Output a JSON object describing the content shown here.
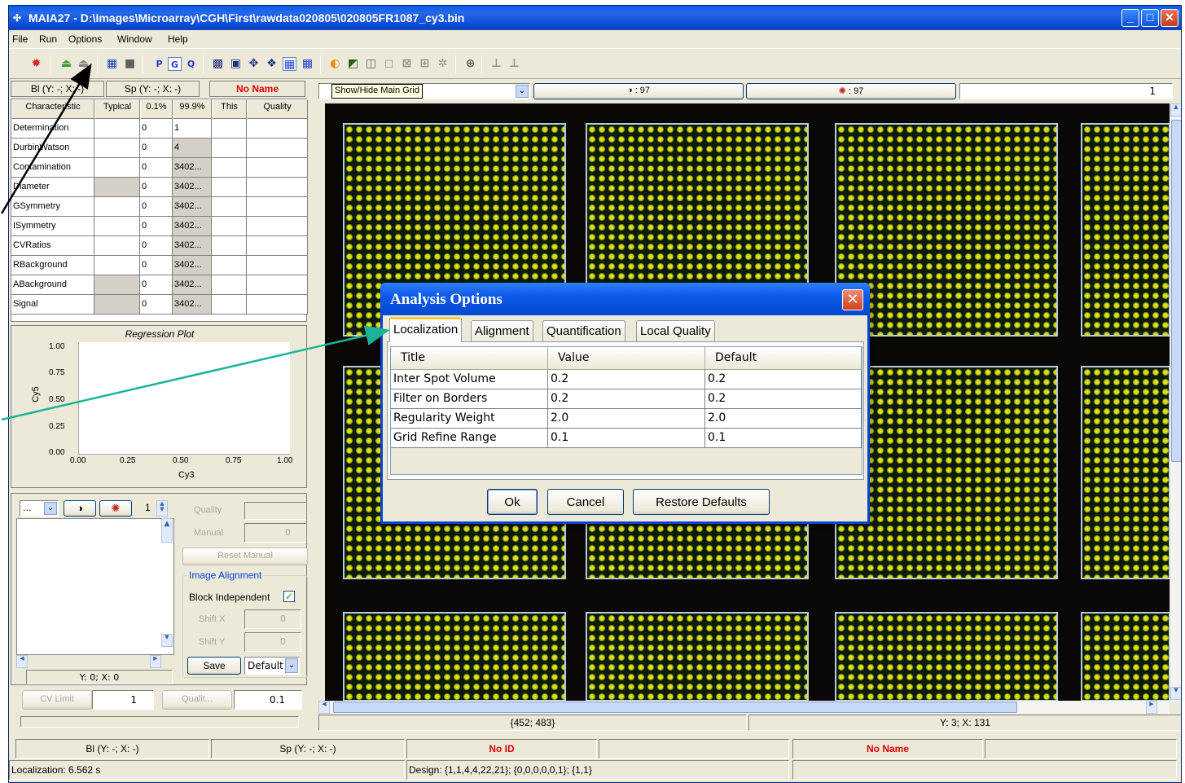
{
  "window": {
    "title": "MAIA27 - D:\\Images\\Microarray\\CGH\\First\\rawdata020805\\020805FR1087_cy3.bin"
  },
  "menu": [
    "File",
    "Run",
    "Options",
    "Window",
    "Help"
  ],
  "toolbar": {
    "tooltip": "Show/Hide Main Grid",
    "p": "P",
    "g": "G",
    "q": "Q"
  },
  "left": {
    "tabs": {
      "bl": "Bl (Y: -; X: -)",
      "sp": "Sp (Y: -; X: -)",
      "name": "No Name"
    },
    "table": {
      "headers": [
        "Characteristic",
        "Typical",
        "0.1%",
        "99.9%",
        "This",
        "Quality"
      ],
      "rows": [
        [
          "Determination",
          "",
          "0",
          "1",
          "",
          ""
        ],
        [
          "DurbinWatson",
          "",
          "0",
          "4",
          "",
          ""
        ],
        [
          "Contamination",
          "",
          "0",
          "3402...",
          "",
          ""
        ],
        [
          "Diameter",
          "",
          "0",
          "3402...",
          "",
          ""
        ],
        [
          "GSymmetry",
          "",
          "0",
          "3402...",
          "",
          ""
        ],
        [
          "ISymmetry",
          "",
          "0",
          "3402...",
          "",
          ""
        ],
        [
          "CVRatios",
          "",
          "0",
          "3402...",
          "",
          ""
        ],
        [
          "RBackground",
          "",
          "0",
          "3402...",
          "",
          ""
        ],
        [
          "ABackground",
          "",
          "0",
          "3402...",
          "",
          ""
        ],
        [
          "Signal",
          "",
          "0",
          "3402...",
          "",
          ""
        ]
      ]
    },
    "plot": {
      "title": "Regression Plot",
      "xlabel": "Cy3",
      "ylabel": "Cy5",
      "xticks": [
        "0.00",
        "0.25",
        "0.50",
        "0.75",
        "1.00"
      ],
      "yticks": [
        "1.00",
        "0.75",
        "0.50",
        "0.25",
        "0.00"
      ]
    },
    "controls": {
      "combo": "...",
      "spin1": "1",
      "quality": "Quality",
      "manual": "Manual",
      "manual_val": "0",
      "reset": "Reset Manual",
      "image_alignment": "Image Alignment",
      "block_independent": "Block Independent",
      "shiftx": "Shift X",
      "shiftx_val": "0",
      "shifty": "Shift Y",
      "shifty_val": "0",
      "save": "Save",
      "default": "Default",
      "coord": "Y: 0; X: 0",
      "cv_limit": "CV Limit",
      "cv_val": "1",
      "qualit": "Qualit...",
      "qualit_val": "0.1"
    }
  },
  "image": {
    "counter1": ": 97",
    "counter2": ": 97",
    "spin": "1",
    "status_left": "{452; 483}",
    "status_right": "Y: 3; X: 131"
  },
  "dialog": {
    "title": "Analysis Options",
    "tabs": [
      "Localization",
      "Alignment",
      "Quantification",
      "Local Quality"
    ],
    "headers": [
      "Title",
      "Value",
      "Default"
    ],
    "rows": [
      [
        "Inter Spot Volume",
        "0.2",
        "0.2"
      ],
      [
        "Filter on Borders",
        "0.2",
        "0.2"
      ],
      [
        "Regularity Weight",
        "2.0",
        "2.0"
      ],
      [
        "Grid Refine Range",
        "0.1",
        "0.1"
      ]
    ],
    "ok": "Ok",
    "cancel": "Cancel",
    "restore": "Restore Defaults"
  },
  "statusbar": {
    "bl": "Bl (Y: -; X: -)",
    "sp": "Sp (Y: -; X: -)",
    "noid": "No ID",
    "noname": "No Name",
    "localization": "Localization: 6.562 s",
    "design": "Design: {1,1,4,4,22,21}; {0,0,0,0,0,1}; {1,1}"
  },
  "colors": {
    "title_blue": "#0a5cea",
    "arrow_black": "#000000",
    "arrow_teal": "#1ab39a",
    "spot_yellow": "#f2e21a",
    "error_red": "#e00000"
  }
}
